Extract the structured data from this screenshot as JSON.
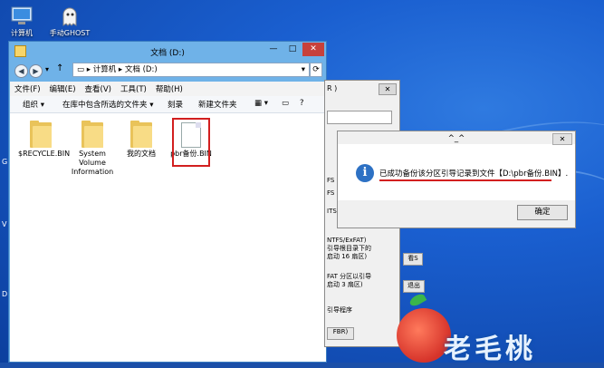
{
  "desktop": {
    "icons": [
      {
        "label": "计算机",
        "icon": "computer-icon"
      },
      {
        "label": "手动GHOST",
        "icon": "ghost-icon"
      }
    ],
    "edge_letters": [
      "G",
      "V",
      "D"
    ]
  },
  "explorer": {
    "title": "文档 (D:)",
    "breadcrumb": [
      "计算机",
      "文档 (D:)"
    ],
    "menu": [
      "文件(F)",
      "编辑(E)",
      "查看(V)",
      "工具(T)",
      "帮助(H)"
    ],
    "toolbar": {
      "organize": "组织 ▾",
      "include_in_library": "在库中包含所选的文件夹 ▾",
      "burn": "刻录",
      "new_folder": "新建文件夹"
    },
    "files": [
      {
        "name": "$RECYCLE.BIN",
        "type": "folder"
      },
      {
        "name": "System Volume Information",
        "type": "folder"
      },
      {
        "name": "我的文档",
        "type": "folder"
      },
      {
        "name": "pbr备份.BIN",
        "type": "file",
        "highlighted": true
      }
    ]
  },
  "tool": {
    "title_fragment": "R )",
    "lines": [
      "FS",
      "FS",
      "ITS",
      "NTFS/ExFAT)",
      "引导根目录下的",
      "启动 16 扇区)",
      "FAT 分区以引导",
      "启动 3 扇区)",
      "引导程序"
    ],
    "buttons": [
      "看S",
      "退出",
      "FBR)"
    ]
  },
  "dialog": {
    "title": "^_^",
    "message": "已成功备份该分区引导记录到文件【D:\\pbr备份.BIN】.",
    "ok": "确定"
  },
  "logo": {
    "text": "老毛桃"
  },
  "colors": {
    "accent_red": "#d21f1f",
    "info_blue": "#2d71c4",
    "desktop": "#1a5fd0"
  }
}
